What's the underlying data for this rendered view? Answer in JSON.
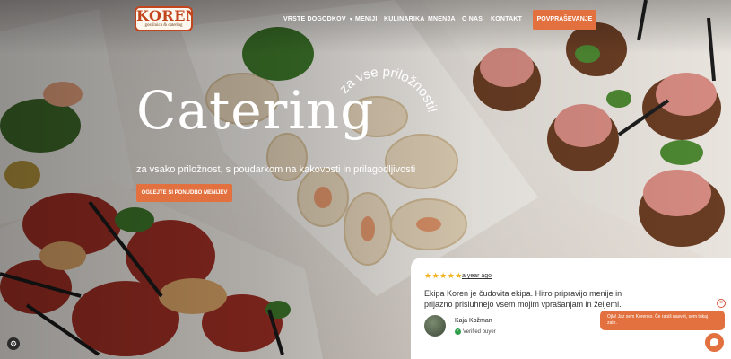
{
  "brand": {
    "name": "KOREN",
    "tagline": "gostilnica & catering",
    "accent_color": "#e2713f"
  },
  "nav": {
    "items": [
      {
        "label": "VRSTE DOGODKOV",
        "has_dropdown": true
      },
      {
        "label": "MENIJI"
      },
      {
        "label": "KULINARIKA"
      },
      {
        "label": "MNENJA"
      },
      {
        "label": "O NAS"
      },
      {
        "label": "KONTAKT"
      }
    ],
    "cta_label": "POVPRAŠEVANJE"
  },
  "hero": {
    "title": "Catering",
    "arc_text": "za vse priložnosti!",
    "subtitle": "za vsako priložnost, s poudarkom na kakovosti in prilagodljivosti",
    "cta_label": "OGLEJTE SI PONUDBO MENIJEV"
  },
  "review": {
    "stars": "★★★★★",
    "rating": 5,
    "date": "a year ago",
    "text": "Ekipa Koren je čudovita ekipa. Hitro pripravijo menije in prijazno prisluhnejo vsem mojim vprašanjam in željemi.",
    "author": "Kaja Kožman",
    "verified_label": "Verified buyer"
  },
  "chat": {
    "message": "Ojla! Jaz sem Korenko. Če rabiš nasvet, sem tukaj zate.",
    "close_icon": "close-icon",
    "launcher_icon": "chat-icon"
  },
  "settings": {
    "icon": "gear-icon"
  }
}
